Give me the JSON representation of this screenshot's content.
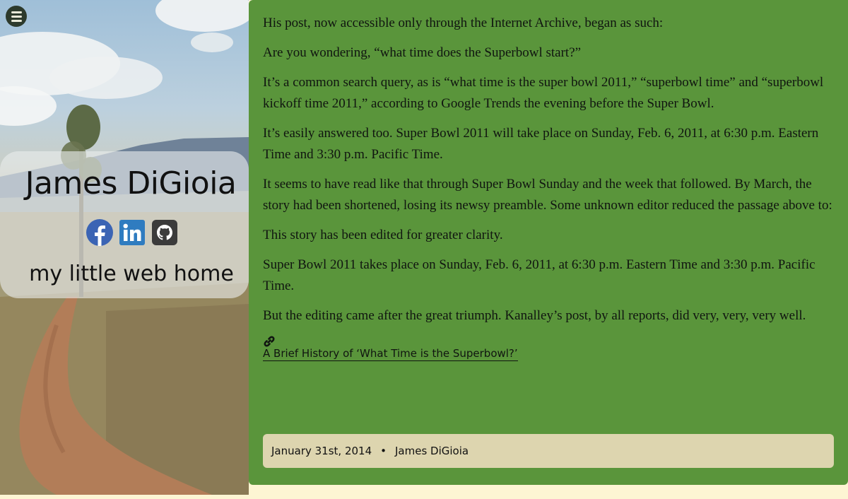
{
  "sidebar": {
    "menu_icon": "hamburger-menu-icon",
    "name": "James DiGioia",
    "tagline": "my little web home",
    "social_icons": [
      "facebook-icon",
      "linkedin-icon",
      "github-icon"
    ]
  },
  "article": {
    "paragraphs": [
      "His post, now accessible only through the Internet Archive, began as such:",
      "Are you wondering, “what time does the Superbowl start?”",
      "It’s a common search query, as is “what time is the super bowl 2011,” “superbowl time” and “superbowl kickoff time 2011,” according to Google Trends the evening before the Super Bowl.",
      "It’s easily answered too. Super Bowl 2011 will take place on Sunday, Feb. 6, 2011, at 6:30 p.m. Eastern Time and 3:30 p.m. Pacific Time.",
      "It seems to have read like that through Super Bowl Sunday and the week that followed. By March, the story had been shortened, losing its newsy preamble. Some unknown editor reduced the passage above to:",
      "This story has been edited for greater clarity.",
      "Super Bowl 2011 takes place on Sunday, Feb. 6, 2011, at 6:30 p.m. Eastern Time and 3:30 p.m. Pacific Time.",
      "But the editing came after the great triumph. Kanalley’s post, by all reports, did very, very, very well."
    ],
    "link_icon": "link-icon",
    "source_link": "A Brief History of ‘What Time is the Superbowl?’",
    "meta": {
      "date": "January 31st, 2014",
      "separator": "•",
      "author": "James DiGioia"
    }
  },
  "colors": {
    "article_bg": "#5a953b",
    "meta_bg": "#ddd5af",
    "page_bg": "#fdf5d3"
  }
}
